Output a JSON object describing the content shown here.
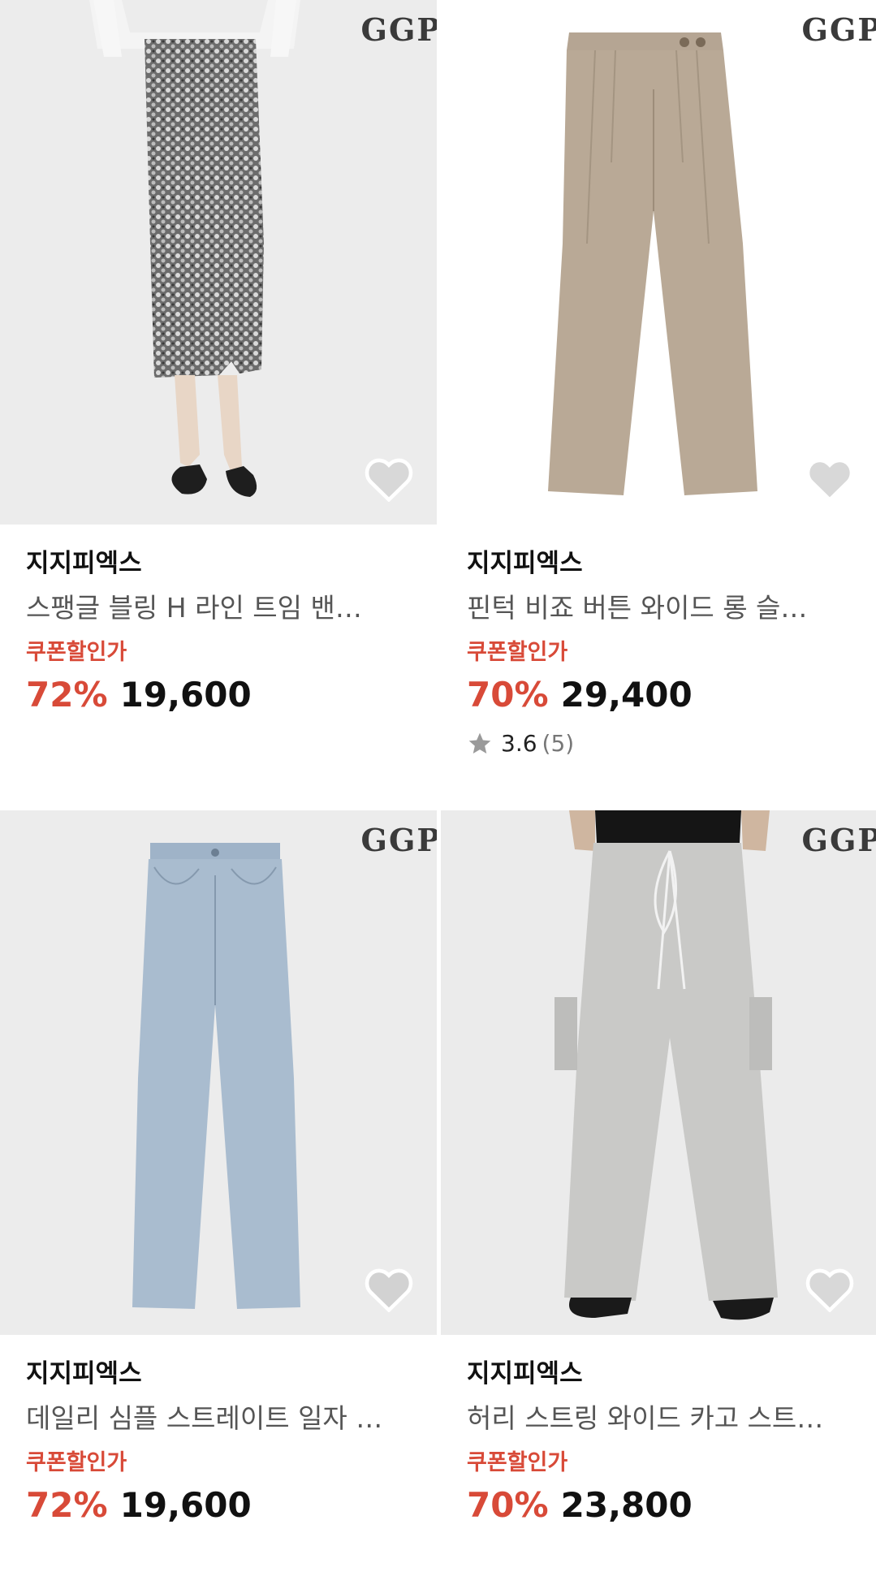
{
  "products": [
    {
      "brand_mark": "GGP",
      "seller": "지지피엑스",
      "title": "스팽글 블링 H 라인 트임 밴…",
      "coupon_label": "쿠폰할인가",
      "discount": "72%",
      "price": "19,600",
      "wishlisted": false,
      "icon": "heart-icon"
    },
    {
      "brand_mark": "GGP",
      "seller": "지지피엑스",
      "title": "핀턱 비죠 버튼 와이드 롱 슬…",
      "coupon_label": "쿠폰할인가",
      "discount": "70%",
      "price": "29,400",
      "rating": "3.6",
      "review_count": "(5)",
      "wishlisted": false,
      "icon": "heart-icon"
    },
    {
      "brand_mark": "GGP",
      "seller": "지지피엑스",
      "title": "데일리 심플 스트레이트 일자 …",
      "coupon_label": "쿠폰할인가",
      "discount": "72%",
      "price": "19,600",
      "wishlisted": false,
      "icon": "heart-icon"
    },
    {
      "brand_mark": "GGP",
      "seller": "지지피엑스",
      "title": "허리 스트링 와이드 카고 스트…",
      "coupon_label": "쿠폰할인가",
      "discount": "70%",
      "price": "23,800",
      "wishlisted": false,
      "icon": "heart-icon"
    }
  ],
  "colors": {
    "accent_red": "#d84a38",
    "text_dark": "#111111",
    "text_muted": "#555555"
  }
}
